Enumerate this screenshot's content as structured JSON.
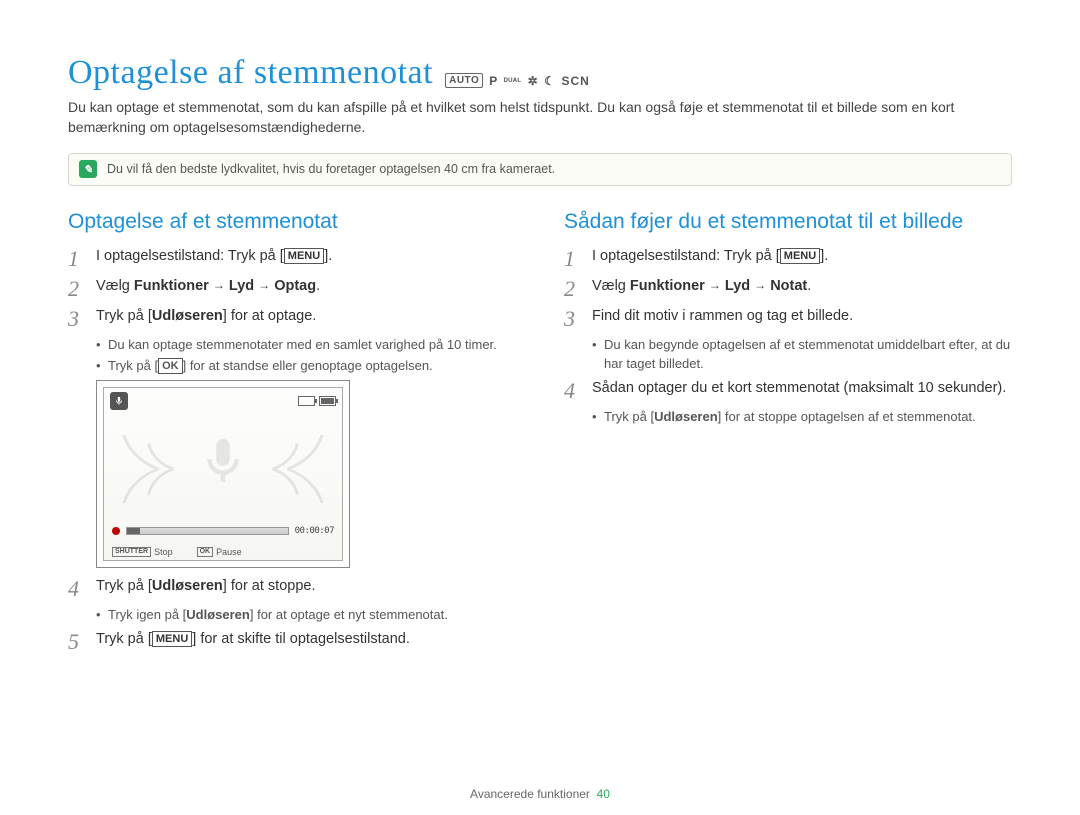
{
  "header": {
    "title": "Optagelse af stemmenotat",
    "mode_icons": [
      "AUTO",
      "P",
      "DUAL",
      "night-icon",
      "moon-icon",
      "SCN"
    ]
  },
  "intro": "Du kan optage et stemmenotat, som du kan afspille på et hvilket som helst tidspunkt. Du kan også føje et stemmenotat til et billede som en kort bemærkning om optagelsesomstændighederne.",
  "note": {
    "text": "Du vil få den bedste lydkvalitet, hvis du foretager optagelsen 40 cm fra kameraet."
  },
  "left": {
    "title": "Optagelse af et stemmenotat",
    "steps": {
      "s1": {
        "prefix": "I optagelsestilstand: Tryk på [",
        "btn": "MENU",
        "suffix": "]."
      },
      "s2": {
        "prefix": "Vælg ",
        "b1": "Funktioner",
        "arrow1": "→",
        "b2": "Lyd",
        "arrow2": "→",
        "b3": "Optag",
        "suffix": "."
      },
      "s3": {
        "prefix": "Tryk på [",
        "b1": "Udløseren",
        "suffix": "] for at optage."
      },
      "s3_bullets": {
        "a": "Du kan optage stemmenotater med en samlet varighed på 10 timer.",
        "b_pre": "Tryk på [",
        "b_btn": "OK",
        "b_post": "] for at standse eller genoptage optagelsen."
      },
      "s4": {
        "prefix": "Tryk på [",
        "b1": "Udløseren",
        "suffix": "] for at stoppe."
      },
      "s4_bullets": {
        "a_pre": "Tryk igen på [",
        "a_b": "Udløseren",
        "a_post": "] for at optage et nyt stemmenotat."
      },
      "s5": {
        "prefix": "Tryk på [",
        "btn": "MENU",
        "suffix": "] for at skifte til optagelsestilstand."
      }
    },
    "lcd": {
      "timer": "00:00:07",
      "shutter_label": "SHUTTER",
      "stop": "Stop",
      "ok_label": "OK",
      "pause": "Pause"
    }
  },
  "right": {
    "title": "Sådan føjer du et stemmenotat til et billede",
    "steps": {
      "s1": {
        "prefix": "I optagelsestilstand: Tryk på [",
        "btn": "MENU",
        "suffix": "]."
      },
      "s2": {
        "prefix": "Vælg ",
        "b1": "Funktioner",
        "arrow1": "→",
        "b2": "Lyd",
        "arrow2": "→",
        "b3": "Notat",
        "suffix": "."
      },
      "s3": {
        "text": "Find dit motiv i rammen og tag et billede."
      },
      "s3_bullets": {
        "a": "Du kan begynde optagelsen af et stemmenotat umiddelbart efter, at du har taget billedet."
      },
      "s4": {
        "text": "Sådan optager du et kort stemmenotat (maksimalt 10 sekunder)."
      },
      "s4_bullets": {
        "a_pre": "Tryk på [",
        "a_b": "Udløseren",
        "a_post": "] for at stoppe optagelsen af et stemmenotat."
      }
    }
  },
  "footer": {
    "section": "Avancerede funktioner",
    "page": "40"
  }
}
